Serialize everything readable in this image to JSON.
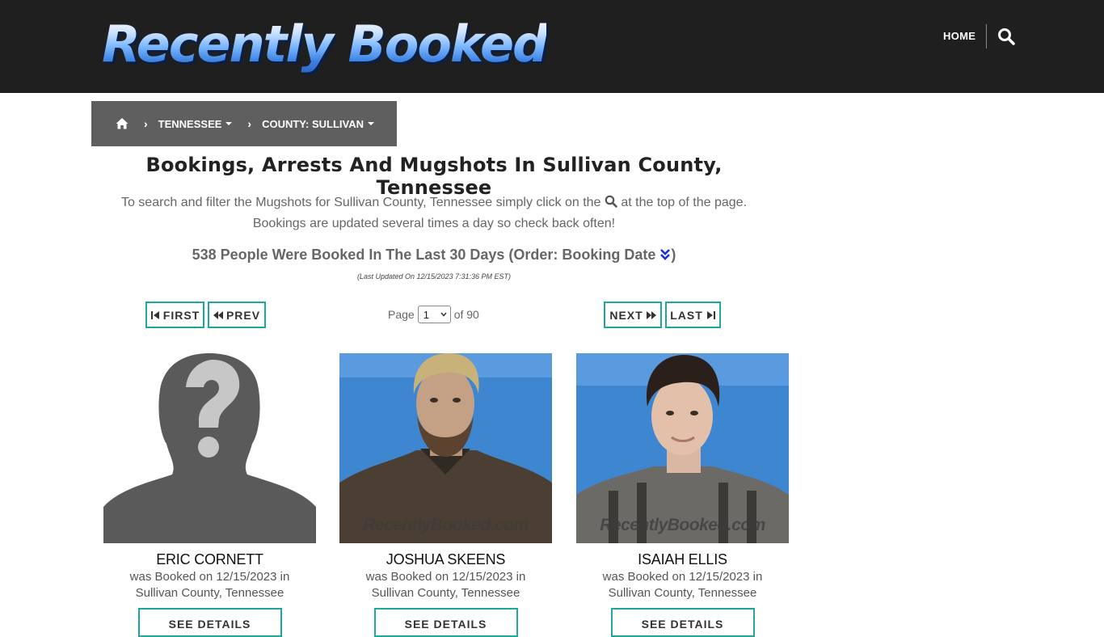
{
  "header": {
    "logo_text": "Recently Booked",
    "nav_home": "HOME",
    "search_icon": "search-icon"
  },
  "breadcrumb": {
    "home_icon": "home-icon",
    "items": [
      {
        "label": "TENNESSEE"
      },
      {
        "label": "COUNTY: SULLIVAN"
      }
    ]
  },
  "main": {
    "title": "Bookings, Arrests And Mugshots In Sullivan County, Tennessee",
    "intro_part1": "To search and filter the Mugshots for Sullivan County, Tennessee simply click on the",
    "intro_part2": "at the top of the page.",
    "intro_line2": "Bookings are updated several times a day so check back often!",
    "count_text": "538 People Were Booked In The Last 30 Days (Order: Booking Date",
    "count_close": ")",
    "last_updated": "(Last Updated On 12/15/2023 7:31:36 PM EST)"
  },
  "pager": {
    "first": "FIRST",
    "prev": "PREV",
    "page_label": "Page",
    "current_page": "1",
    "of_label": "of 90",
    "next": "NEXT",
    "last": "LAST"
  },
  "cards": [
    {
      "name": "ERIC CORNETT",
      "line1": "was Booked on 12/15/2023 in",
      "line2": "Sullivan County, Tennessee",
      "button": "SEE DETAILS",
      "photo": "placeholder-silhouette",
      "watermark": ""
    },
    {
      "name": "JOSHUA SKEENS",
      "line1": "was Booked on 12/15/2023 in",
      "line2": "Sullivan County, Tennessee",
      "button": "SEE DETAILS",
      "photo": "mugshot",
      "watermark": "RecentlyBooked.com"
    },
    {
      "name": "ISAIAH ELLIS",
      "line1": "was Booked on 12/15/2023 in",
      "line2": "Sullivan County, Tennessee",
      "button": "SEE DETAILS",
      "photo": "mugshot",
      "watermark": "RecentlyBooked.com"
    }
  ],
  "colors": {
    "header_bg": "#1f1f1f",
    "breadcrumb_bg": "#5f5f5f",
    "accent_teal": "#1ea79a",
    "mugshot_bg": "#3f86d0"
  }
}
